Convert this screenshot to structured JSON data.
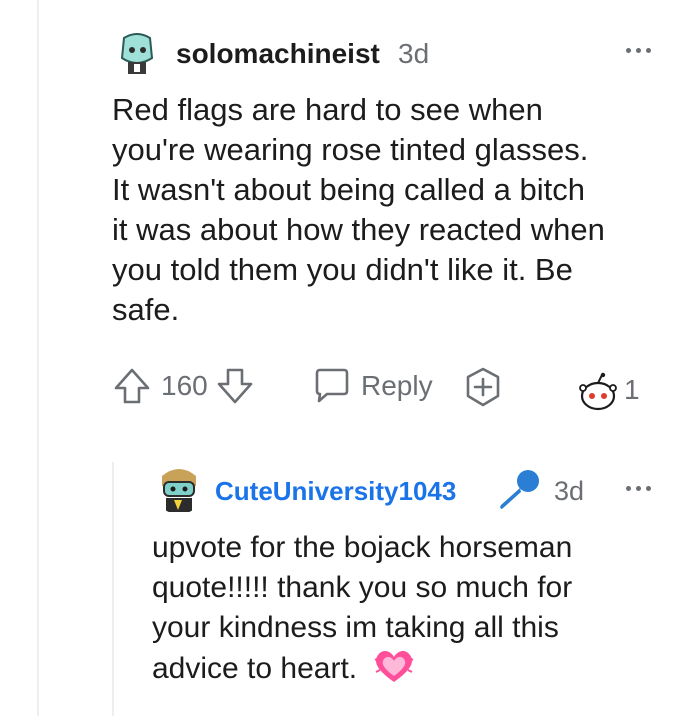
{
  "comment": {
    "username": "solomachineist",
    "age": "3d",
    "lines": [
      "Red flags are hard to see when",
      "you're wearing rose tinted glasses.",
      "It wasn't about being called a bitch",
      "it was about how they reacted when",
      "you told them you didn't like it. Be",
      "safe."
    ],
    "score": "160",
    "reply_label": "Reply",
    "awards_count": "1"
  },
  "reply": {
    "username": "CuteUniversity1043",
    "age": "3d",
    "lines": [
      "upvote for the bojack horseman",
      "quote!!!!! thank you so much for",
      "your kindness im taking all this",
      "advice to heart."
    ]
  },
  "colors": {
    "username_blue": "#1a73e8",
    "mic_blue": "#2a7fd4",
    "gray": "#6b6f73",
    "heart_pink": "#ff4f9a"
  }
}
